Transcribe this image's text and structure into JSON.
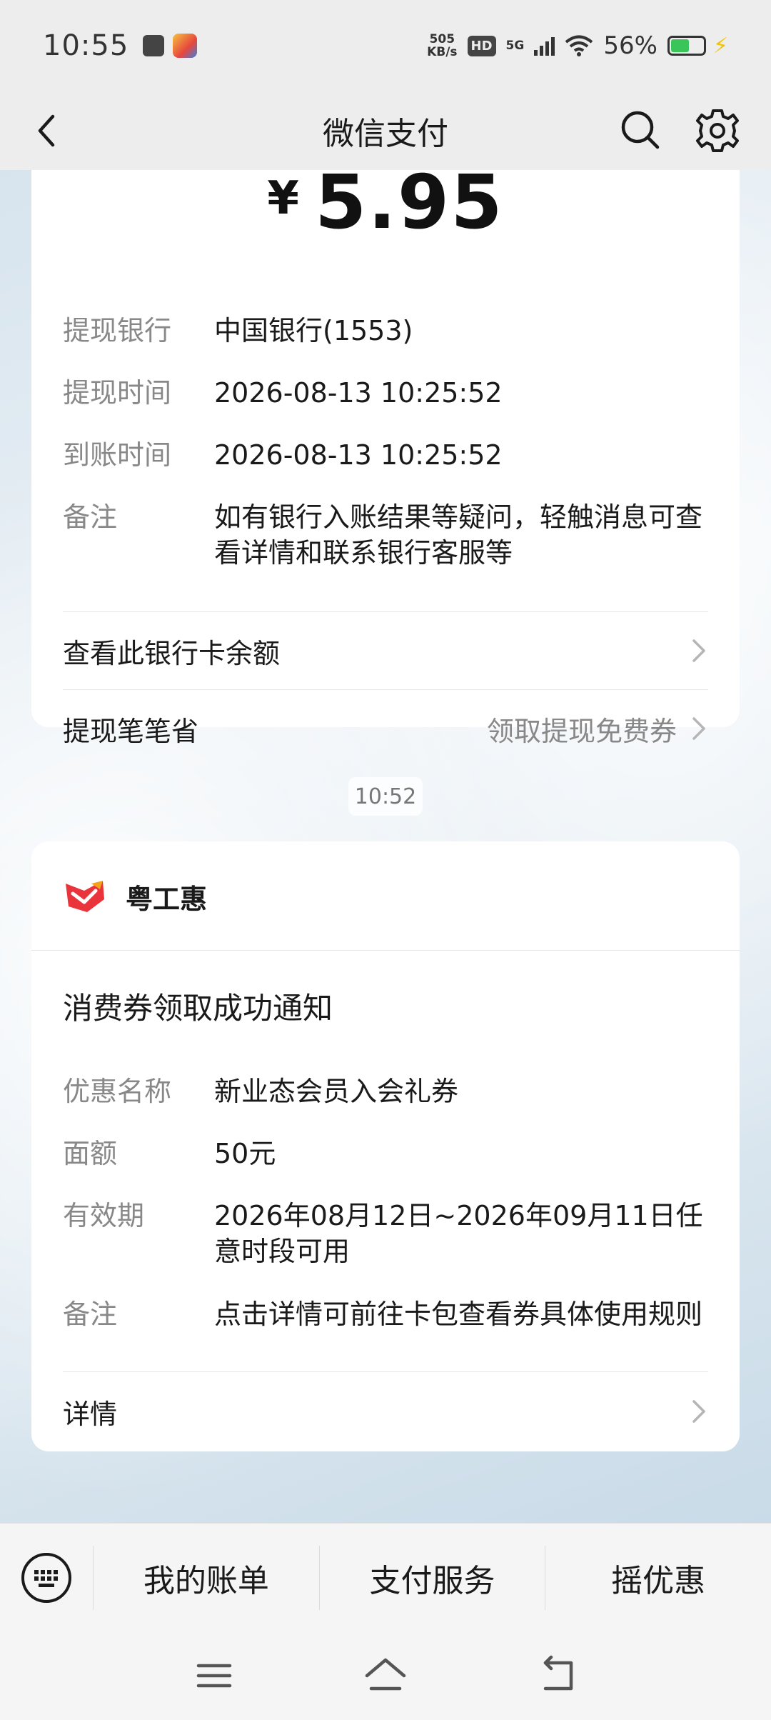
{
  "status_bar": {
    "time": "10:55",
    "speed_value": "505",
    "speed_unit": "KB/s",
    "hd": "HD",
    "network": "5G",
    "battery": "56%",
    "battery_level": 0.56
  },
  "nav": {
    "title": "微信支付"
  },
  "withdraw_card": {
    "currency": "¥",
    "amount": "5.95",
    "rows": [
      {
        "key": "提现银行",
        "value": "中国银行(1553)"
      },
      {
        "key": "提现时间",
        "value": "2026-08-13 10:25:52"
      },
      {
        "key": "到账时间",
        "value": "2026-08-13 10:25:52"
      },
      {
        "key": "备注",
        "value": "如有银行入账结果等疑问，轻触消息可查看详情和联系银行客服等"
      }
    ],
    "link_balance": "查看此银行卡余额",
    "link_save": "提现笔笔省",
    "link_save_extra": "领取提现免费券"
  },
  "message_time": "10:52",
  "coupon_card": {
    "brand": "粤工惠",
    "title": "消费券领取成功通知",
    "rows": [
      {
        "key": "优惠名称",
        "value": "新业态会员入会礼券"
      },
      {
        "key": "面额",
        "value": "50元"
      },
      {
        "key": "有效期",
        "value": "2026年08月12日~2026年09月11日任意时段可用"
      },
      {
        "key": "备注",
        "value": "点击详情可前往卡包查看券具体使用规则"
      }
    ],
    "details": "详情"
  },
  "bottom_menu": {
    "items": [
      "我的账单",
      "支付服务",
      "摇优惠"
    ]
  },
  "colors": {
    "accent_red": "#e8343a",
    "battery_green": "#39c55a",
    "bolt_yellow": "#f2c300"
  }
}
